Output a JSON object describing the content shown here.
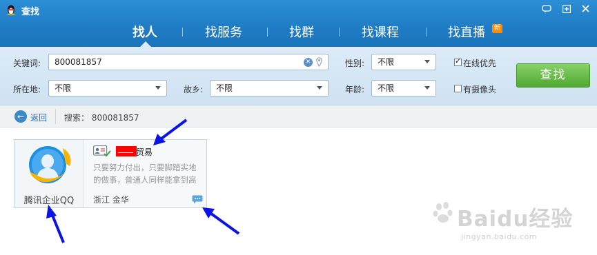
{
  "window": {
    "title": "查找"
  },
  "tabs": [
    {
      "label": "找人",
      "active": true
    },
    {
      "label": "找服务",
      "active": false
    },
    {
      "label": "找群",
      "active": false
    },
    {
      "label": "找课程",
      "active": false
    },
    {
      "label": "找直播",
      "active": false,
      "badge": "新"
    }
  ],
  "search": {
    "keyword_label": "关键词:",
    "keyword_value": "800081857",
    "location_label": "所在地:",
    "location_value": "不限",
    "hometown_label": "故乡:",
    "hometown_value": "不限",
    "gender_label": "性别:",
    "gender_value": "不限",
    "age_label": "年龄:",
    "age_value": "不限",
    "online_first_label": "在线优先",
    "online_first_checked": true,
    "has_camera_label": "有摄像头",
    "has_camera_checked": false,
    "search_button": "查找"
  },
  "result_bar": {
    "back_label": "返回",
    "summary": "搜索： 800081857"
  },
  "result_card": {
    "company_label": "腾讯企业QQ",
    "name_visible": "贸易",
    "description": "只要努力付出，只要脚踏实地的做事，普通人同样能拿到高",
    "location": "浙江 金华"
  },
  "colors": {
    "header_blue": "#1f7cc4",
    "search_panel": "#dcebf7",
    "search_button_green": "#4fa931",
    "annotation_arrow": "#0a14e6",
    "redaction": "#ff0000"
  },
  "watermark": {
    "brand": "Baidu经验",
    "url": "jingyan.baidu.com"
  }
}
